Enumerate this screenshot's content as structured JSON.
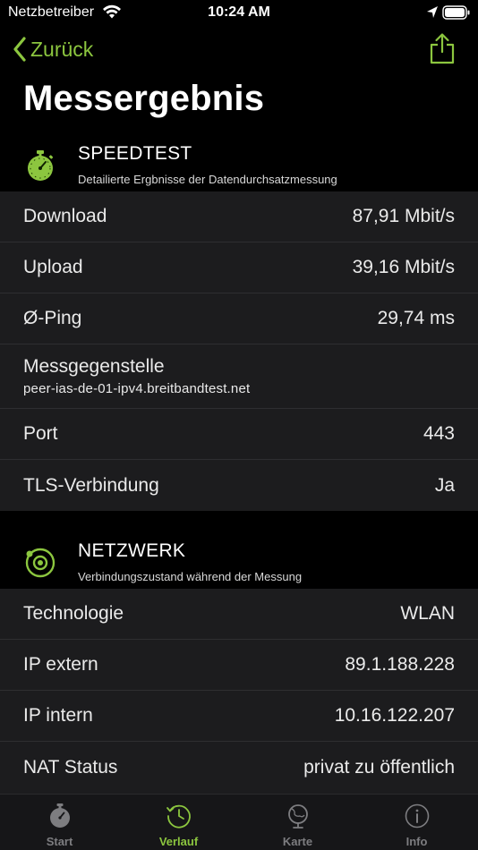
{
  "status_bar": {
    "carrier": "Netzbetreiber",
    "time": "10:24 AM"
  },
  "nav": {
    "back_label": "Zurück"
  },
  "title": "Messergebnis",
  "colors": {
    "accent": "#8cc63f",
    "background": "#000000",
    "cell": "#1c1c1e",
    "tab_inactive": "#7d7d80"
  },
  "speedtest": {
    "title": "SPEEDTEST",
    "subtitle": "Detailierte Ergbnisse der Datendurchsatzmessung",
    "icon": "stopwatch-icon",
    "rows": [
      {
        "label": "Download",
        "value": "87,91 Mbit/s"
      },
      {
        "label": "Upload",
        "value": "39,16 Mbit/s"
      },
      {
        "label": "Ø-Ping",
        "value": "29,74 ms"
      },
      {
        "label": "Messgegenstelle",
        "value": "peer-ias-de-01-ipv4.breitbandtest.net"
      },
      {
        "label": "Port",
        "value": "443"
      },
      {
        "label": "TLS-Verbindung",
        "value": "Ja"
      }
    ]
  },
  "network": {
    "title": "NETZWERK",
    "subtitle": "Verbindungszustand während der Messung",
    "icon": "network-orbit-icon",
    "rows": [
      {
        "label": "Technologie",
        "value": "WLAN"
      },
      {
        "label": "IP extern",
        "value": "89.1.188.228"
      },
      {
        "label": "IP intern",
        "value": "10.16.122.207"
      },
      {
        "label": "NAT Status",
        "value": "privat zu öffentlich"
      }
    ]
  },
  "tabs": [
    {
      "label": "Start",
      "icon": "stopwatch-icon",
      "active": false
    },
    {
      "label": "Verlauf",
      "icon": "history-icon",
      "active": true
    },
    {
      "label": "Karte",
      "icon": "globe-icon",
      "active": false
    },
    {
      "label": "Info",
      "icon": "info-icon",
      "active": false
    }
  ]
}
